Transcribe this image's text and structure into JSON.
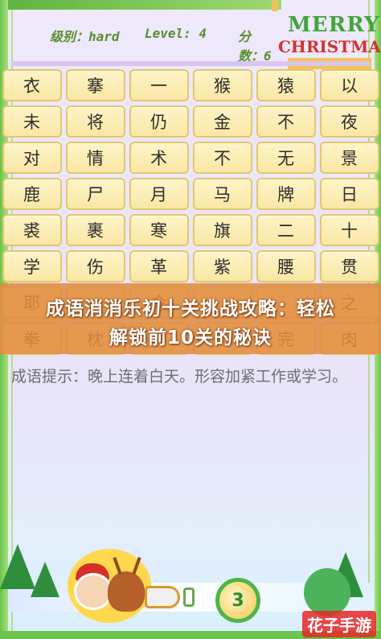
{
  "header": {
    "difficulty_label": "级别：hard",
    "level_label": "Level: 4",
    "score_label": "分数：6"
  },
  "merry": {
    "line1": "MERRY",
    "line2": "CHRISTMAS"
  },
  "grid": {
    "rows": [
      [
        "衣",
        "搴",
        "一",
        "猴",
        "猿",
        "以"
      ],
      [
        "未",
        "将",
        "仍",
        "金",
        "不",
        "夜"
      ],
      [
        "对",
        "情",
        "术",
        "不",
        "无",
        "景"
      ],
      [
        "鹿",
        "尸",
        "月",
        "马",
        "牌",
        "日"
      ],
      [
        "裘",
        "裹",
        "寒",
        "旗",
        "二",
        "十"
      ],
      [
        "学",
        "伤",
        "革",
        "紫",
        "腰",
        "贯"
      ],
      [
        "耶",
        "",
        "令",
        "",
        "",
        "之"
      ],
      [
        "拳",
        "枕",
        "",
        "",
        "完",
        "肉"
      ]
    ]
  },
  "banner": {
    "line1": "成语消消乐初十关挑战攻略：轻松",
    "line2": "解锁前10关的秘诀"
  },
  "hint": {
    "text": "成语提示：晚上连着白天。形容加紧工作或学习。"
  },
  "footer": {
    "cycle_number": "3"
  },
  "watermark": {
    "text": "花子手游"
  },
  "colors": {
    "tile": "#f9e7a5",
    "tile_border": "#e3c76b",
    "banner": "#e18c41",
    "green": "#6cc34e"
  }
}
